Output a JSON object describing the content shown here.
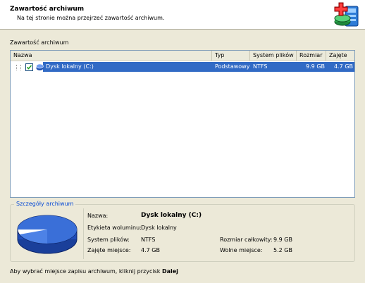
{
  "header": {
    "title": "Zawartość archiwum",
    "subtitle": "Na tej stronie można przejrzeć zawartość archiwum."
  },
  "contents": {
    "label": "Zawartość archiwum",
    "columns": [
      "Nazwa",
      "Typ",
      "System plików",
      "Rozmiar",
      "Zajęte"
    ],
    "rows": [
      {
        "name": "Dysk lokalny (C:)",
        "type": "Podstawowy",
        "filesystem": "NTFS",
        "size": "9.9 GB",
        "used": "4.7 GB",
        "checked": true,
        "selected": true
      }
    ]
  },
  "details": {
    "title": "Szczegóły archiwum",
    "name_label": "Nazwa:",
    "name_value": "Dysk lokalny (C:)",
    "volume_label": "Etykieta woluminu:",
    "volume_value": "Dysk lokalny",
    "fs_label": "System plików:",
    "fs_value": "NTFS",
    "used_label": "Zajęte miejsce:",
    "used_value": "4.7 GB",
    "total_label": "Rozmiar całkowity:",
    "total_value": "9.9 GB",
    "free_label": "Wolne miejsce:",
    "free_value": "5.2 GB"
  },
  "footer": {
    "text": "Aby wybrać miejsce zapisu archiwum, kliknij przycisk ",
    "bold": "Dalej"
  },
  "colors": {
    "selection": "#316ac5",
    "group_title": "#0046d5",
    "disk_blue": "#3a6fd8"
  }
}
